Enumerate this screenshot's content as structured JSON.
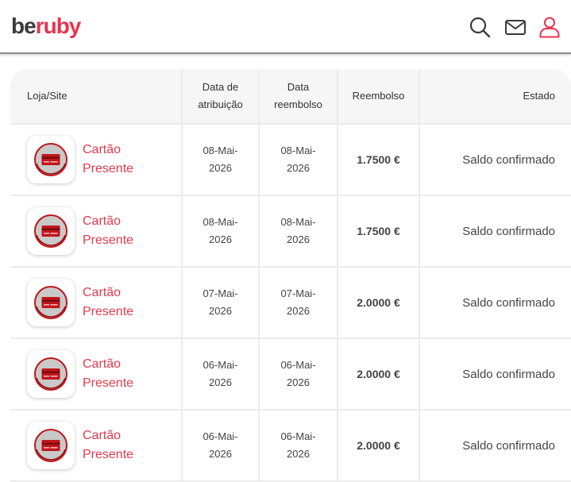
{
  "header": {
    "logo_part1": "be",
    "logo_part2": "ruby",
    "icons": [
      "search-icon",
      "mail-icon",
      "user-icon"
    ]
  },
  "table": {
    "columns": {
      "store": "Loja/Site",
      "attribution_date_line1": "Data de",
      "attribution_date_line2": "atribuição",
      "refund_date_line1": "Data",
      "refund_date_line2": "reembolso",
      "refund": "Reembolso",
      "status": "Estado"
    },
    "rows": [
      {
        "store_line1": "Cartão",
        "store_line2": "Presente",
        "attr_d1": "08-Mai-",
        "attr_d2": "2026",
        "ref_d1": "08-Mai-",
        "ref_d2": "2026",
        "amount": "1.7500 €",
        "status": "Saldo confirmado"
      },
      {
        "store_line1": "Cartão",
        "store_line2": "Presente",
        "attr_d1": "08-Mai-",
        "attr_d2": "2026",
        "ref_d1": "08-Mai-",
        "ref_d2": "2026",
        "amount": "1.7500 €",
        "status": "Saldo confirmado"
      },
      {
        "store_line1": "Cartão",
        "store_line2": "Presente",
        "attr_d1": "07-Mai-",
        "attr_d2": "2026",
        "ref_d1": "07-Mai-",
        "ref_d2": "2026",
        "amount": "2.0000 €",
        "status": "Saldo confirmado"
      },
      {
        "store_line1": "Cartão",
        "store_line2": "Presente",
        "attr_d1": "06-Mai-",
        "attr_d2": "2026",
        "ref_d1": "06-Mai-",
        "ref_d2": "2026",
        "amount": "2.0000 €",
        "status": "Saldo confirmado"
      },
      {
        "store_line1": "Cartão",
        "store_line2": "Presente",
        "attr_d1": "06-Mai-",
        "attr_d2": "2026",
        "ref_d1": "06-Mai-",
        "ref_d2": "2026",
        "amount": "2.0000 €",
        "status": "Saldo confirmado"
      }
    ],
    "store_icon": "gift-card-icon"
  },
  "colors": {
    "brand": "#e8344e",
    "store_text": "#e23a4c",
    "card_red": "#c0161b"
  }
}
